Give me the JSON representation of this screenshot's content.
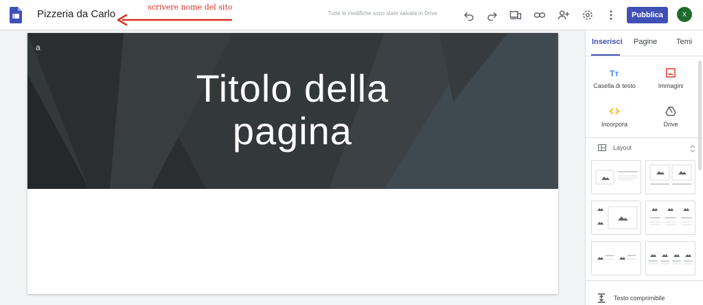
{
  "header": {
    "site_name": "Pizzeria da Carlo",
    "annotation": "scrivere nome del sito",
    "saved_status": "Tutte le modifiche sono state salvate in Drive",
    "publish_label": "Pubblica",
    "avatar_initial": "X"
  },
  "hero": {
    "header_label": "a",
    "title_line1": "Titolo della",
    "title_line2": "pagina"
  },
  "panel": {
    "tabs": [
      {
        "label": "Inserisci",
        "active": true
      },
      {
        "label": "Pagine",
        "active": false
      },
      {
        "label": "Temi",
        "active": false
      }
    ],
    "insert_items": [
      {
        "label": "Casella di testo",
        "icon": "text-box-icon"
      },
      {
        "label": "Immagini",
        "icon": "image-icon"
      },
      {
        "label": "Incorpora",
        "icon": "embed-icon"
      },
      {
        "label": "Drive",
        "icon": "drive-icon"
      }
    ],
    "layout_label": "Layout",
    "collapsible_label": "Testo comprimibile"
  },
  "colors": {
    "accent": "#3f51b5",
    "annotation": "#d93025",
    "hero_bg": "#2f3437",
    "avatar": "#1e6b2c"
  }
}
